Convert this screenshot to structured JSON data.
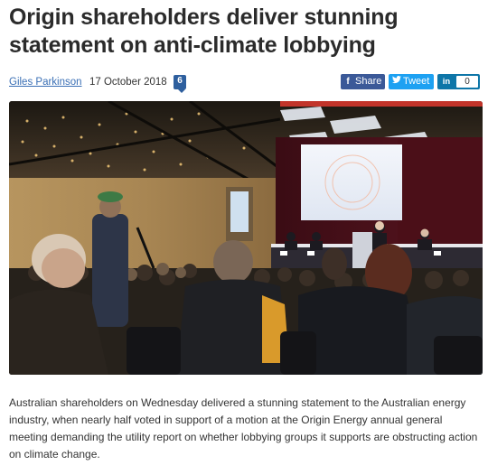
{
  "article": {
    "title": "Origin shareholders deliver stunning statement on anti-climate lobbying",
    "author": "Giles Parkinson",
    "date": "17 October 2018",
    "comment_count": "6",
    "body": "Australian shareholders on Wednesday delivered a stunning statement to the Australian energy industry, when nearly half voted in support of a motion at the Origin Energy annual general meeting demanding the utility report on whether lobbying groups it supports are obstructing action on climate change."
  },
  "share": {
    "facebook_label": "Share",
    "twitter_label": "Tweet",
    "linkedin_count": "0",
    "facebook_icon": "f",
    "linkedin_icon": "in",
    "twitter_icon": "bird-icon"
  },
  "colors": {
    "link": "#3a6fb5",
    "badge": "#2e5f9e",
    "facebook": "#3b5998",
    "twitter": "#1da1f2",
    "linkedin": "#0e76a8"
  }
}
